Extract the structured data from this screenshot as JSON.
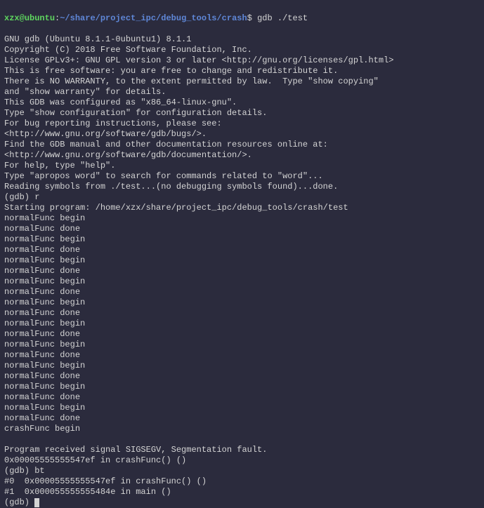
{
  "prompt": {
    "user": "xzx",
    "at": "@",
    "host": "ubuntu",
    "colon": ":",
    "path": "~/share/project_ipc/debug_tools/crash",
    "dollar": "$",
    "command": " gdb ./test"
  },
  "gdb_header": [
    "GNU gdb (Ubuntu 8.1.1-0ubuntu1) 8.1.1",
    "Copyright (C) 2018 Free Software Foundation, Inc.",
    "License GPLv3+: GNU GPL version 3 or later <http://gnu.org/licenses/gpl.html>",
    "This is free software: you are free to change and redistribute it.",
    "There is NO WARRANTY, to the extent permitted by law.  Type \"show copying\"",
    "and \"show warranty\" for details.",
    "This GDB was configured as \"x86_64-linux-gnu\".",
    "Type \"show configuration\" for configuration details.",
    "For bug reporting instructions, please see:",
    "<http://www.gnu.org/software/gdb/bugs/>.",
    "Find the GDB manual and other documentation resources online at:",
    "<http://www.gnu.org/software/gdb/documentation/>.",
    "For help, type \"help\".",
    "Type \"apropos word\" to search for commands related to \"word\"...",
    "Reading symbols from ./test...(no debugging symbols found)...done."
  ],
  "gdb_run": {
    "prompt": "(gdb) r",
    "starting": "Starting program: /home/xzx/share/project_ipc/debug_tools/crash/test"
  },
  "normal_runs": [
    "normalFunc begin",
    "normalFunc done",
    "normalFunc begin",
    "normalFunc done",
    "normalFunc begin",
    "normalFunc done",
    "normalFunc begin",
    "normalFunc done",
    "normalFunc begin",
    "normalFunc done",
    "normalFunc begin",
    "normalFunc done",
    "normalFunc begin",
    "normalFunc done",
    "normalFunc begin",
    "normalFunc done",
    "normalFunc begin",
    "normalFunc done",
    "normalFunc begin",
    "normalFunc done"
  ],
  "crash": {
    "begin": "crashFunc begin",
    "blank": "",
    "signal": "Program received signal SIGSEGV, Segmentation fault.",
    "location": "0x00005555555547ef in crashFunc() ()"
  },
  "backtrace": {
    "prompt": "(gdb) bt",
    "frame0": "#0  0x00005555555547ef in crashFunc() ()",
    "frame1": "#1  0x000055555555484e in main ()"
  },
  "final_prompt": "(gdb) "
}
